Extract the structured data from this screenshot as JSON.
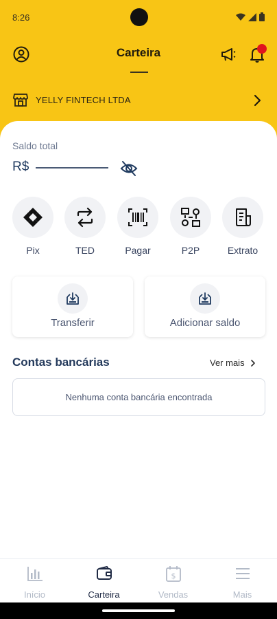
{
  "status_bar": {
    "time": "8:26"
  },
  "app_bar": {
    "title": "Carteira"
  },
  "company": {
    "name": "YELLY FINTECH LTDA"
  },
  "balance": {
    "label": "Saldo total",
    "currency": "R$"
  },
  "quick_actions": [
    {
      "label": "Pix",
      "icon": "pix-icon"
    },
    {
      "label": "TED",
      "icon": "transfer-arrows-icon"
    },
    {
      "label": "Pagar",
      "icon": "barcode-icon"
    },
    {
      "label": "P2P",
      "icon": "p2p-icon"
    },
    {
      "label": "Extrato",
      "icon": "statement-icon"
    }
  ],
  "cards": {
    "transfer_label": "Transferir",
    "add_balance_label": "Adicionar saldo"
  },
  "bank_accounts": {
    "title": "Contas bancárias",
    "see_more": "Ver mais",
    "empty_message": "Nenhuma conta bancária encontrada"
  },
  "bottom_nav": [
    {
      "label": "Início",
      "icon": "chart-icon",
      "active": false
    },
    {
      "label": "Carteira",
      "icon": "wallet-icon",
      "active": true
    },
    {
      "label": "Vendas",
      "icon": "sales-calendar-icon",
      "active": false
    },
    {
      "label": "Mais",
      "icon": "menu-icon",
      "active": false
    }
  ],
  "colors": {
    "brand_yellow": "#F8C515",
    "notification_red": "#E0141E",
    "text_dark_blue": "#23395b"
  }
}
